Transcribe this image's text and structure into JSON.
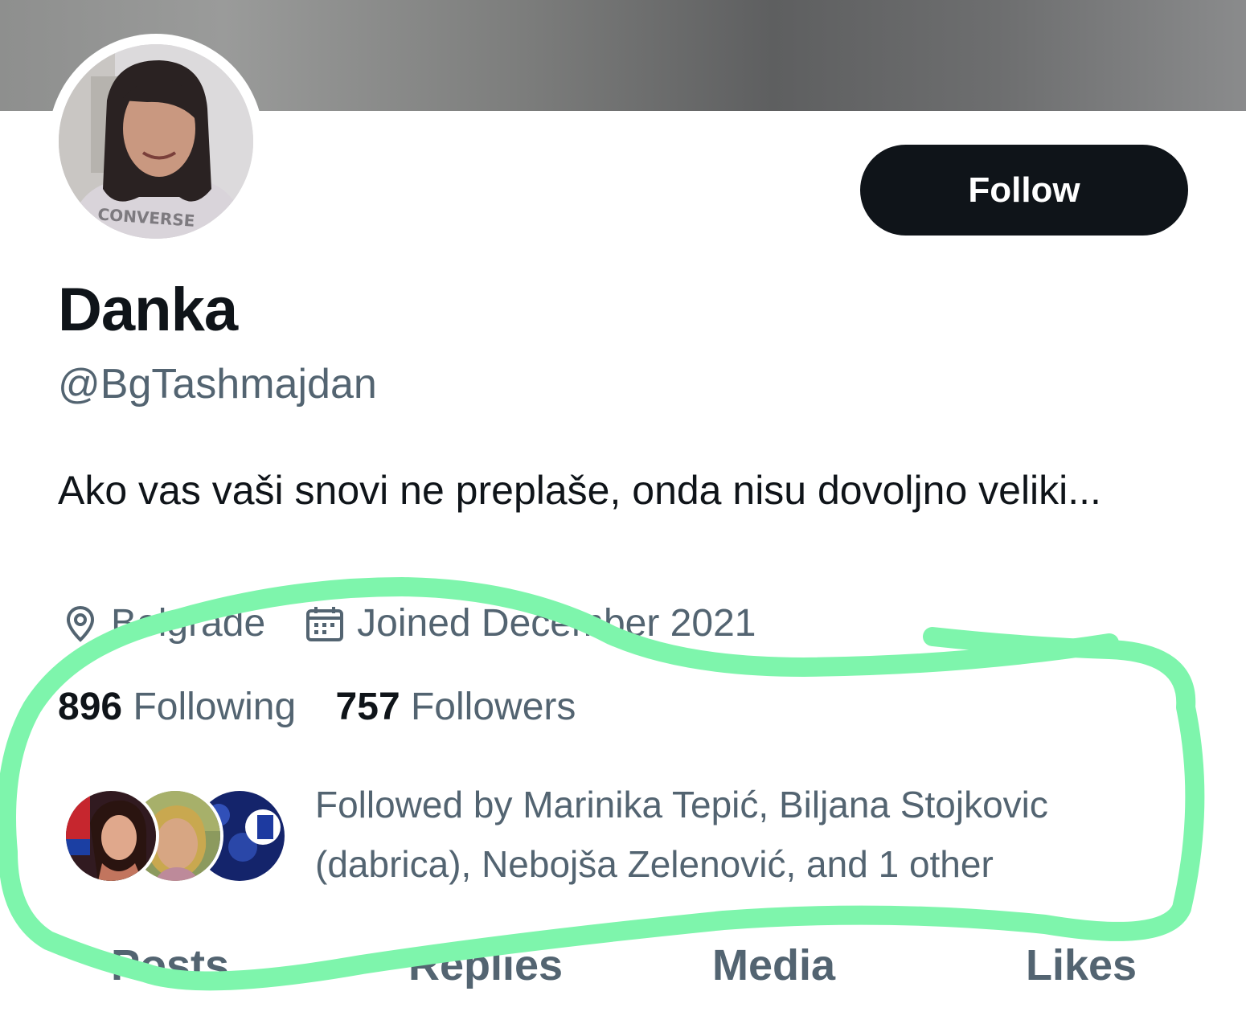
{
  "profile": {
    "name": "Danka",
    "handle": "@BgTashmajdan",
    "bio": "Ako vas vaši snovi ne preplaše, onda nisu dovoljno veliki...",
    "location": "Belgrade",
    "joined": "Joined December 2021",
    "avatar_shirt_text": "CONVERSE",
    "follow_label": "Follow"
  },
  "stats": {
    "following_count": "896",
    "following_label": "Following",
    "followers_count": "757",
    "followers_label": "Followers"
  },
  "followed_by": {
    "text": "Followed by Marinika Tepić, Biljana Stojkovic (dabrica), Nebojša Zelenović, and 1 other"
  },
  "tabs": [
    "Posts",
    "Replies",
    "Media",
    "Likes"
  ],
  "icons": {
    "location": "location-pin-icon",
    "joined": "calendar-icon"
  },
  "colors": {
    "primary_text": "#0f1419",
    "secondary_text": "#536471",
    "button_bg": "#0f1419",
    "annotation": "#7ef5ac"
  }
}
